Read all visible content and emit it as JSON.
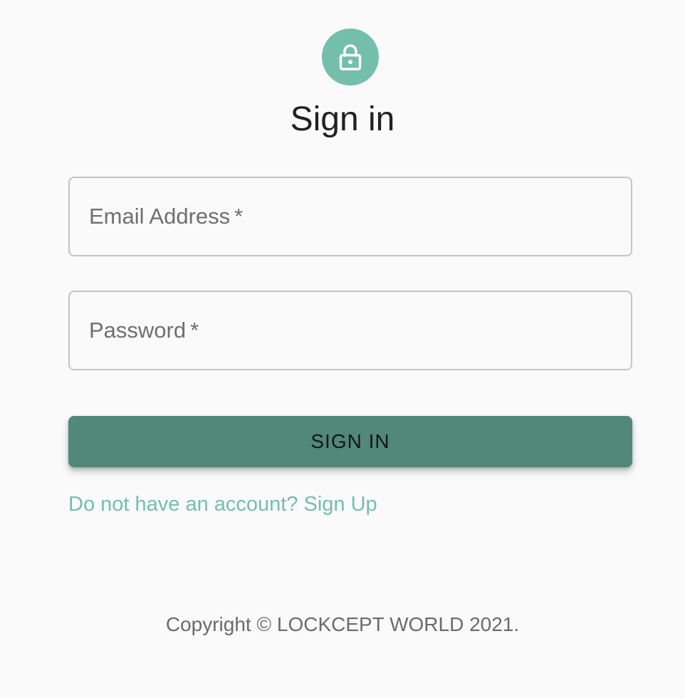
{
  "header": {
    "icon": "lock-icon",
    "title": "Sign in"
  },
  "form": {
    "email": {
      "label": "Email Address",
      "required_marker": "*",
      "value": ""
    },
    "password": {
      "label": "Password",
      "required_marker": "*",
      "value": ""
    },
    "submit_label": "SIGN IN",
    "signup_link": "Do not have an account? Sign Up"
  },
  "footer": {
    "copyright": "Copyright © LOCKCEPT WORLD 2021."
  },
  "colors": {
    "accent": "#73bfac",
    "button": "#518878",
    "background": "#fafafa"
  }
}
